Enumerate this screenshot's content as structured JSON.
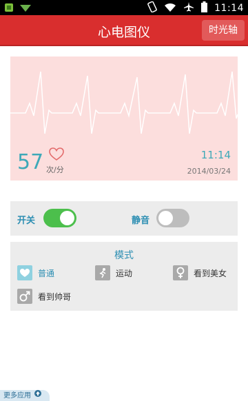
{
  "status_bar": {
    "time": "11:14",
    "icons": [
      "notification-icon",
      "download-icon",
      "rotate-icon",
      "wifi-icon",
      "airplane-icon",
      "battery-icon"
    ]
  },
  "header": {
    "title": "心电图仪",
    "timeline_button": "时光轴"
  },
  "ecg": {
    "heart_rate": "57",
    "heart_rate_unit": "次/分",
    "time": "11:14",
    "date": "2014/03/24"
  },
  "switches": {
    "power_label": "开关",
    "power_on": true,
    "mute_label": "静音",
    "mute_on": false
  },
  "mode": {
    "title": "模式",
    "items": [
      {
        "label": "普通",
        "icon": "heart-icon",
        "active": true
      },
      {
        "label": "运动",
        "icon": "runner-icon",
        "active": false
      },
      {
        "label": "看到美女",
        "icon": "female-icon",
        "active": false
      },
      {
        "label": "看到帅哥",
        "icon": "male-icon",
        "active": false
      }
    ]
  },
  "footer": {
    "more_apps": "更多应用"
  },
  "colors": {
    "header_red": "#d92e2e",
    "accent_teal": "#3ea9b8",
    "toggle_green": "#4cbf4c",
    "panel_pink": "#fcdedd"
  }
}
